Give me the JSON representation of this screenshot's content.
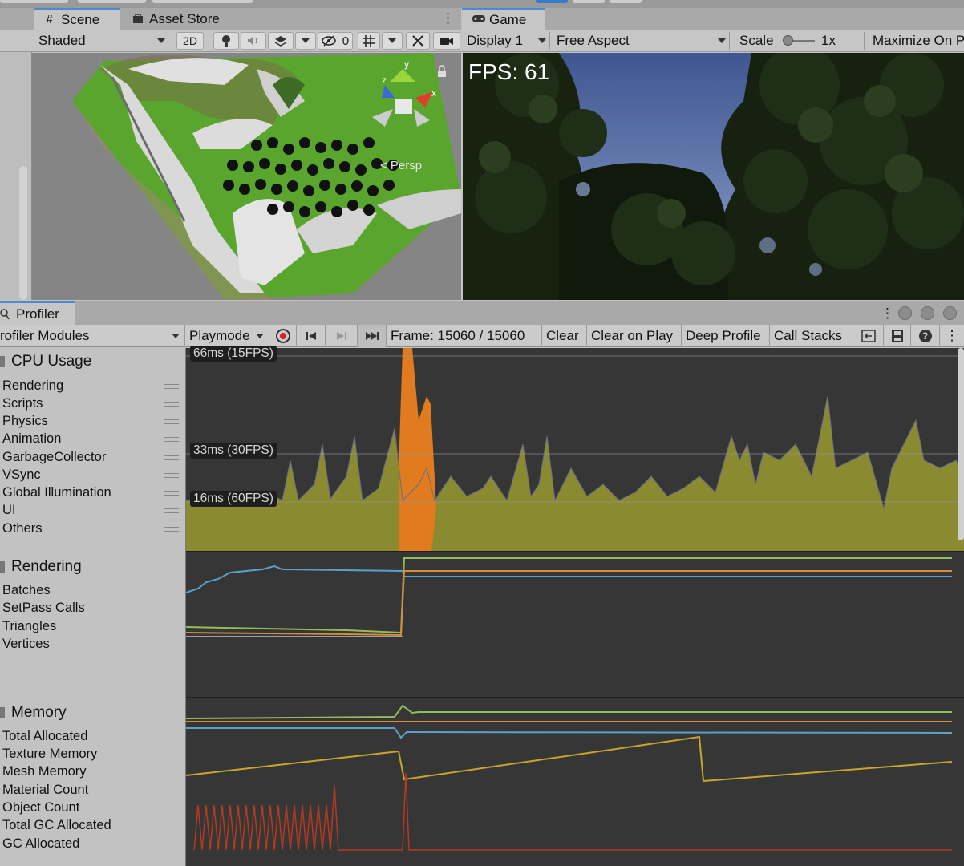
{
  "scene_panel": {
    "tabs": [
      {
        "label": "Scene",
        "icon": "grid-icon"
      },
      {
        "label": "Asset Store",
        "icon": "bag-icon"
      }
    ],
    "toolbar": {
      "shading_mode": "Shaded",
      "mode_2d": "2D",
      "hidden_count": "0"
    },
    "view_label": "< Persp",
    "gizmo_axes": {
      "x": "x",
      "y": "y",
      "z": "z"
    }
  },
  "game_panel": {
    "tab": {
      "label": "Game",
      "icon": "gamepad-icon"
    },
    "toolbar": {
      "display": "Display 1",
      "aspect": "Free Aspect",
      "scale_label": "Scale",
      "scale_value": "1x",
      "maximize": "Maximize On P"
    },
    "fps_text": "FPS: 61"
  },
  "profiler": {
    "tab": {
      "label": "Profiler",
      "icon": "profiler-icon"
    },
    "toolbar": {
      "modules_dropdown": "rofiler Modules",
      "target": "Playmode",
      "frame_text": "Frame: 15060 / 15060",
      "clear": "Clear",
      "clear_on_play": "Clear on Play",
      "deep_profile": "Deep Profile",
      "call_stacks": "Call Stacks"
    },
    "modules": {
      "cpu": {
        "title": "CPU Usage",
        "items": [
          "Rendering",
          "Scripts",
          "Physics",
          "Animation",
          "GarbageCollector",
          "VSync",
          "Global Illumination",
          "UI",
          "Others"
        ],
        "labels": [
          "66ms (15FPS)",
          "33ms (30FPS)",
          "16ms (60FPS)"
        ]
      },
      "rendering": {
        "title": "Rendering",
        "items": [
          "Batches",
          "SetPass Calls",
          "Triangles",
          "Vertices"
        ]
      },
      "memory": {
        "title": "Memory",
        "items": [
          "Total Allocated",
          "Texture Memory",
          "Mesh Memory",
          "Material Count",
          "Object Count",
          "Total GC Allocated",
          "GC Allocated"
        ]
      }
    }
  },
  "colors": {
    "cpu_fill": "#8a8a30",
    "cpu_spike": "#e07b1f",
    "chart_bg": "#363636",
    "rendering_blue": "#5aa0c8",
    "rendering_green": "#8fbf5a",
    "rendering_orange": "#d98a3a",
    "memory_yellow": "#c9a52e",
    "memory_red": "#b53a1f",
    "panel_bg": "#c2c2c2"
  }
}
